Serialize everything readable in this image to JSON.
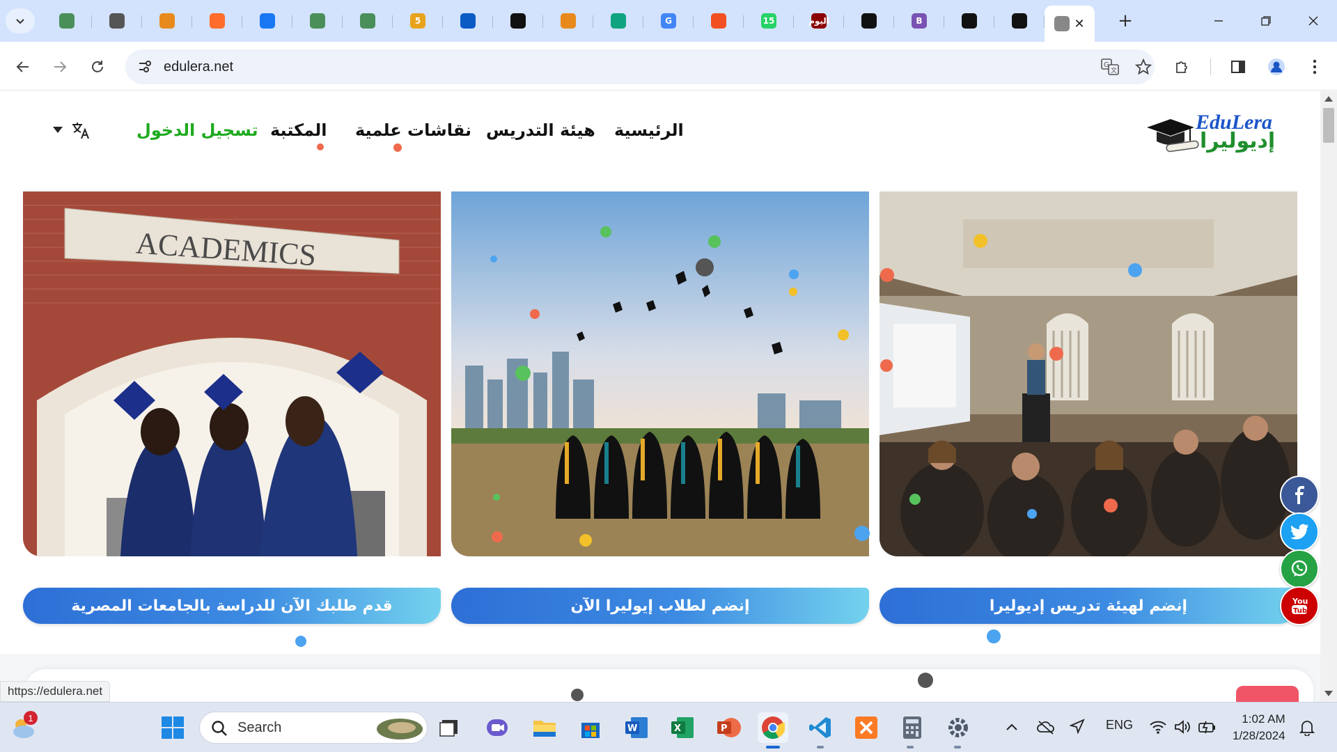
{
  "browser": {
    "tabs": [
      {
        "icon": "chart-bars-icon",
        "color": "#4a8f5a",
        "label": ""
      },
      {
        "icon": "globe-icon",
        "color": "#555555",
        "label": ""
      },
      {
        "icon": "phpmyadmin-icon",
        "color": "#e8891c",
        "label": ""
      },
      {
        "icon": "cpanel-icon",
        "color": "#ff6c2c",
        "label": ""
      },
      {
        "icon": "facebook-icon",
        "color": "#1877f2",
        "label": ""
      },
      {
        "icon": "chart-bars-icon",
        "color": "#4a8f5a",
        "label": ""
      },
      {
        "icon": "chart-bars-icon",
        "color": "#4a8f5a",
        "label": ""
      },
      {
        "icon": "html5-icon",
        "color": "#e8a31c",
        "label": "5"
      },
      {
        "icon": "github-icon",
        "color": "#0a5bc4",
        "label": ""
      },
      {
        "icon": "codepen-icon",
        "color": "#111111",
        "label": ""
      },
      {
        "icon": "phpmyadmin-icon",
        "color": "#e8891c",
        "label": ""
      },
      {
        "icon": "openai-icon",
        "color": "#10a37f",
        "label": ""
      },
      {
        "icon": "google-icon",
        "color": "#4285f4",
        "label": "G"
      },
      {
        "icon": "microsoft-icon",
        "color": "#f25022",
        "label": ""
      },
      {
        "icon": "whatsapp-badge-icon",
        "color": "#25d366",
        "label": "15"
      },
      {
        "icon": "news-icon",
        "color": "#8b0000",
        "label": "اليوم"
      },
      {
        "icon": "codepen-icon",
        "color": "#111111",
        "label": ""
      },
      {
        "icon": "bootstrap-icon",
        "color": "#7952b3",
        "label": "B"
      },
      {
        "icon": "film-icon",
        "color": "#111111",
        "label": ""
      },
      {
        "icon": "codepen-icon",
        "color": "#111111",
        "label": ""
      },
      {
        "icon": "active-tab-icon",
        "color": "#888888",
        "label": ""
      }
    ],
    "url": "edulera.net",
    "status_url": "https://edulera.net"
  },
  "site": {
    "logo_latin": "EduLera",
    "logo_arabic": "إديوليرا",
    "nav": {
      "home": "الرئيسية",
      "faculty": "هيئة التدريس",
      "discussions": "نقاشات علمية",
      "library": "المكتبة",
      "login": "تسجيل الدخول"
    },
    "cards": [
      {
        "image": "classroom-lecture-image",
        "cta": "إنضم لهيئة تدريس إديوليرا"
      },
      {
        "image": "graduates-throwing-caps-image",
        "cta": "إنضم لطلاب إيوليرا الآن"
      },
      {
        "image": "academics-building-graduates-image",
        "cta": "قدم طلبك الآن للدراسة بالجامعات المصرية",
        "sign_text": "ACADEMICS"
      }
    ],
    "social": [
      {
        "name": "facebook",
        "color": "#3b5998"
      },
      {
        "name": "twitter",
        "color": "#1da1f2"
      },
      {
        "name": "whatsapp",
        "color": "#25a244"
      },
      {
        "name": "youtube",
        "color": "#cc0000"
      }
    ]
  },
  "taskbar": {
    "search_label": "Search",
    "weather_badge": "1",
    "language": "ENG",
    "time": "1:02 AM",
    "date": "1/28/2024"
  }
}
